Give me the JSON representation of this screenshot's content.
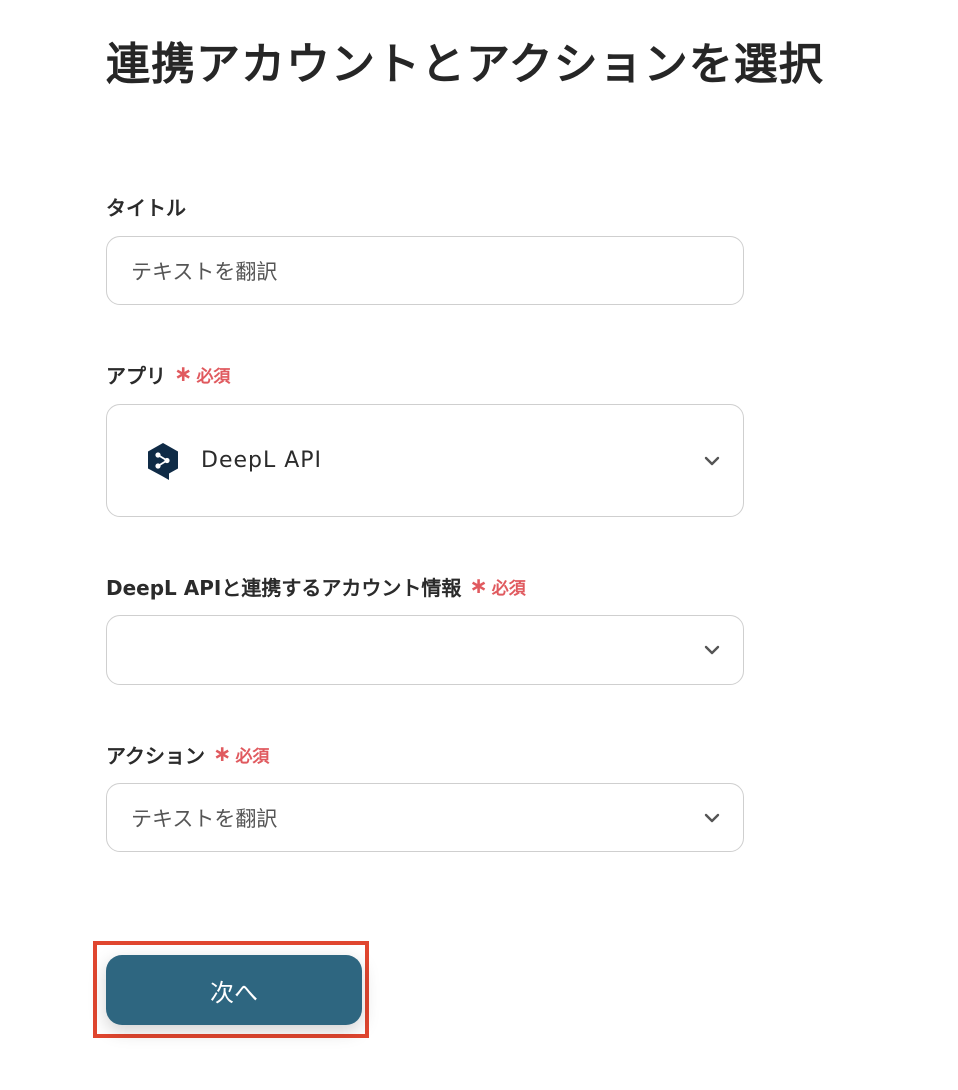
{
  "page_title": "連携アカウントとアクションを選択",
  "fields": {
    "title": {
      "label": "タイトル",
      "value": "テキストを翻訳"
    },
    "app": {
      "label": "アプリ",
      "required_text": "必須",
      "value": "DeepL API",
      "icon": "deepl-logo-icon"
    },
    "account": {
      "label": "DeepL APIと連携するアカウント情報",
      "required_text": "必須",
      "value": ""
    },
    "action": {
      "label": "アクション",
      "required_text": "必須",
      "value": "テキストを翻訳"
    }
  },
  "required_mark": "∗",
  "next_button": {
    "label": "次へ"
  },
  "colors": {
    "required": "#e05a5f",
    "primary_button": "#2e6680",
    "highlight": "#e0462f",
    "deepl_logo": "#0f2b46"
  }
}
